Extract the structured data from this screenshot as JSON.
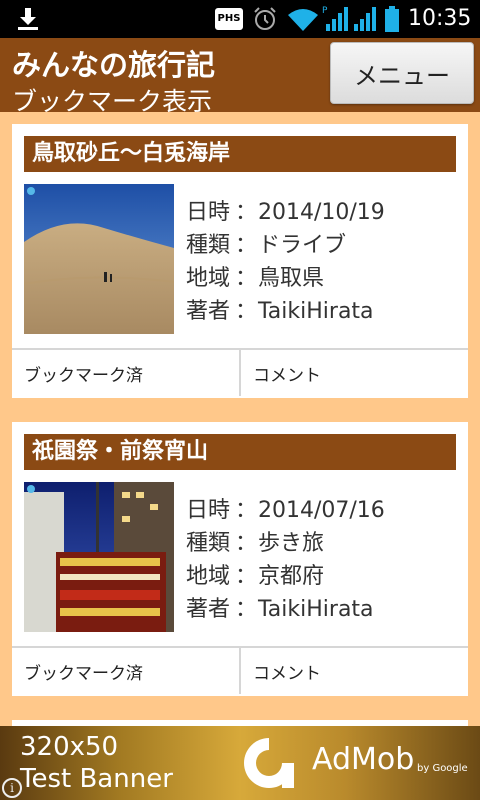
{
  "status_bar": {
    "time": "10:35",
    "phs_label": "PHS",
    "icons": [
      "download-icon",
      "phs-icon",
      "alarm-icon",
      "wifi-icon",
      "signal-icon",
      "battery-icon"
    ]
  },
  "header": {
    "title": "みんなの旅行記",
    "subtitle": "ブックマーク表示",
    "menu_label": "メニュー"
  },
  "cards": [
    {
      "title": "鳥取砂丘～白兎海岸",
      "date_label": "日時",
      "date": "2014/10/19",
      "type_label": "種類",
      "type": "ドライブ",
      "region_label": "地域",
      "region": "鳥取県",
      "author_label": "著者",
      "author": "TaikiHirata",
      "bookmark_label": "ブックマーク済",
      "comment_label": "コメント"
    },
    {
      "title": "祇園祭・前祭宵山",
      "date_label": "日時",
      "date": "2014/07/16",
      "type_label": "種類",
      "type": "歩き旅",
      "region_label": "地域",
      "region": "京都府",
      "author_label": "著者",
      "author": "TaikiHirata",
      "bookmark_label": "ブックマーク済",
      "comment_label": "コメント"
    }
  ],
  "separator": "：",
  "ad": {
    "line1": "320x50",
    "line2": "Test Banner",
    "brand": "AdMob",
    "by": "by Google",
    "info": "i"
  },
  "colors": {
    "header_bg": "#8b4a14",
    "page_bg": "#ffc88a",
    "card_title_bg": "#8b4a14"
  }
}
